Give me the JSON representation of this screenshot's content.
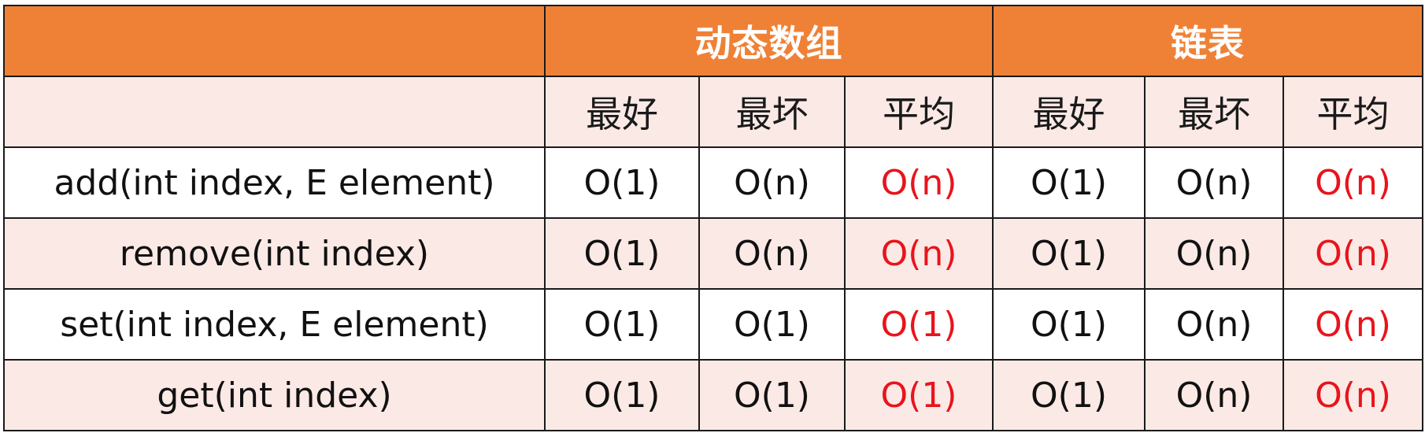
{
  "header": {
    "empty_label": "",
    "group_dynamic_array": "动态数组",
    "group_linked_list": "链表",
    "sub_labels": [
      "最好",
      "最坏",
      "平均",
      "最好",
      "最坏",
      "平均"
    ]
  },
  "rows": [
    {
      "op": "add(int index, E element)",
      "array": [
        "O(1)",
        "O(n)",
        "O(n)"
      ],
      "linked": [
        "O(1)",
        "O(n)",
        "O(n)"
      ]
    },
    {
      "op": "remove(int index)",
      "array": [
        "O(1)",
        "O(n)",
        "O(n)"
      ],
      "linked": [
        "O(1)",
        "O(n)",
        "O(n)"
      ]
    },
    {
      "op": "set(int index, E element)",
      "array": [
        "O(1)",
        "O(1)",
        "O(1)"
      ],
      "linked": [
        "O(1)",
        "O(n)",
        "O(n)"
      ]
    },
    {
      "op": "get(int index)",
      "array": [
        "O(1)",
        "O(1)",
        "O(1)"
      ],
      "linked": [
        "O(1)",
        "O(n)",
        "O(n)"
      ]
    }
  ],
  "colors": {
    "header_bg": "#ef8136",
    "header_text": "#ffffff",
    "alt_row_bg": "#fbe9e6",
    "average_text": "#e8141c",
    "border": "#1a1a1a"
  }
}
